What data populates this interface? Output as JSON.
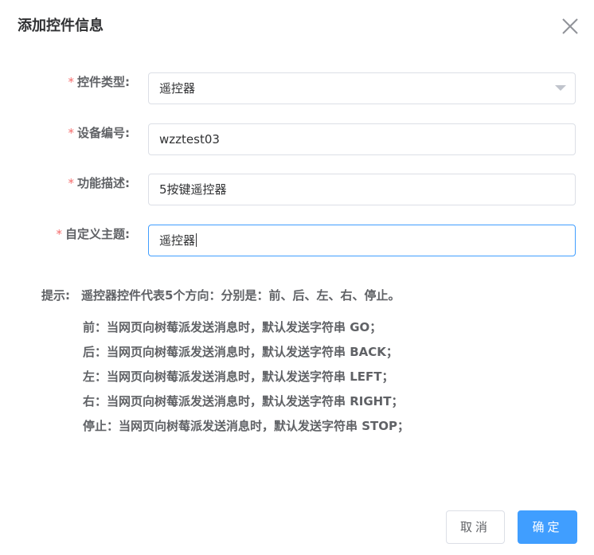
{
  "dialog": {
    "title": "添加控件信息",
    "close_icon": "close-icon"
  },
  "form": {
    "required_mark": "*",
    "fields": [
      {
        "label": "控件类型:",
        "value": "遥控器",
        "type": "select"
      },
      {
        "label": "设备编号:",
        "value": "wzztest03",
        "type": "input"
      },
      {
        "label": "功能描述:",
        "value": "5按键遥控器",
        "type": "input"
      },
      {
        "label": "自定义主题:",
        "value": "遥控器",
        "type": "input",
        "focused": true
      }
    ]
  },
  "tips": {
    "label": "提示:",
    "summary": "遥控器控件代表5个方向：分别是：前、后、左、右、停止。",
    "lines": [
      "前：当网页向树莓派发送消息时，默认发送字符串 GO；",
      "后：当网页向树莓派发送消息时，默认发送字符串 BACK；",
      "左：当网页向树莓派发送消息时，默认发送字符串 LEFT；",
      "右：当网页向树莓派发送消息时，默认发送字符串 RIGHT；",
      "停止：当网页向树莓派发送消息时，默认发送字符串 STOP；"
    ]
  },
  "footer": {
    "cancel_label": "取消",
    "confirm_label": "确定"
  },
  "colors": {
    "primary": "#409eff",
    "required": "#f56c6c",
    "border": "#dcdfe6"
  }
}
